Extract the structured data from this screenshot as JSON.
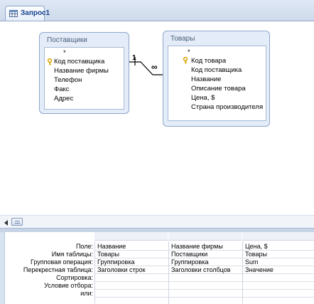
{
  "tab": {
    "label": "Запрос1"
  },
  "tables": [
    {
      "title": "Поставщики",
      "fields": [
        {
          "name": "*",
          "key": false
        },
        {
          "name": "Код поставщика",
          "key": true
        },
        {
          "name": "Название фирмы",
          "key": false
        },
        {
          "name": "Телефон",
          "key": false
        },
        {
          "name": "Факс",
          "key": false
        },
        {
          "name": "Адрес",
          "key": false
        }
      ]
    },
    {
      "title": "Товары",
      "fields": [
        {
          "name": "*",
          "key": false
        },
        {
          "name": "Код товара",
          "key": true
        },
        {
          "name": "Код поставщика",
          "key": false
        },
        {
          "name": "Название",
          "key": false
        },
        {
          "name": "Описание товара",
          "key": false
        },
        {
          "name": "Цена, $",
          "key": false
        },
        {
          "name": "Страна производителя",
          "key": false
        }
      ]
    }
  ],
  "relationship": {
    "one_label": "1",
    "many_label": "∞"
  },
  "grid": {
    "row_labels": [
      "Поле:",
      "Имя таблицы:",
      "Групповая операция:",
      "Перекрестная таблица:",
      "Сортировка:",
      "Условие отбора:",
      "или:"
    ],
    "columns": [
      {
        "values": [
          "Название",
          "Товары",
          "Группировка",
          "Заголовки строк",
          "",
          "",
          ""
        ]
      },
      {
        "values": [
          "Название фирмы",
          "Поставщики",
          "Группировка",
          "Заголовки столбцов",
          "",
          "",
          ""
        ]
      },
      {
        "values": [
          "Цена, $",
          "Товары",
          "Sum",
          "Значение",
          "",
          "",
          ""
        ]
      }
    ]
  },
  "colors": {
    "tab_text": "#15428b",
    "table_header_bg": "#e3ecf8",
    "table_border": "#8fa7c8",
    "key_icon": "#d9a400"
  },
  "icons": {
    "tab_icon": "query-datasheet-icon",
    "key_icon": "primary-key-icon",
    "scroll_left": "scroll-left-arrow-icon"
  }
}
